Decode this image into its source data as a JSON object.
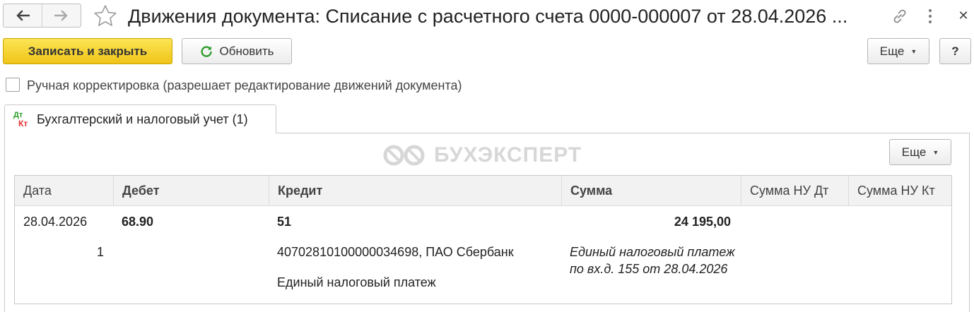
{
  "window": {
    "title": "Движения документа: Списание с расчетного счета 0000-000007 от 28.04.2026 ..."
  },
  "icons": {
    "back": "arrow-left-icon",
    "forward": "arrow-right-icon",
    "favorite": "star-icon",
    "link": "link-icon",
    "menu": "more-vertical-icon",
    "close": "close-icon",
    "refresh": "refresh-icon",
    "tab": "dt-kt-icon"
  },
  "toolbar": {
    "save_close_label": "Записать и закрыть",
    "refresh_label": "Обновить",
    "more_label": "Еще",
    "help_label": "?"
  },
  "manual_correction": {
    "label": "Ручная корректировка (разрешает редактирование движений документа)",
    "checked": false
  },
  "tab": {
    "label": "Бухгалтерский и налоговый учет (1)"
  },
  "watermark": {
    "text": "БУХЭКСПЕРТ"
  },
  "table_toolbar": {
    "more_label": "Еще"
  },
  "table": {
    "columns": [
      "Дата",
      "Дебет",
      "Кредит",
      "Сумма",
      "Сумма НУ Дт",
      "Сумма НУ Кт"
    ],
    "rows": [
      {
        "date": "28.04.2026",
        "line_number": "1",
        "debit": "68.90",
        "credit": "51",
        "credit_subconto_1": "40702810100000034698, ПАО Сбербанк",
        "credit_subconto_2": "Единый налоговый платеж",
        "amount": "24 195,00",
        "content": "Единый налоговый платеж по вх.д. 155 от 28.04.2026",
        "amount_nu_dt": "",
        "amount_nu_kt": ""
      }
    ]
  },
  "colors": {
    "primary_button": "#f5d233",
    "refresh_icon": "#2e9d2e",
    "dt_green": "#2e9d2e",
    "kt_red": "#e53030"
  }
}
